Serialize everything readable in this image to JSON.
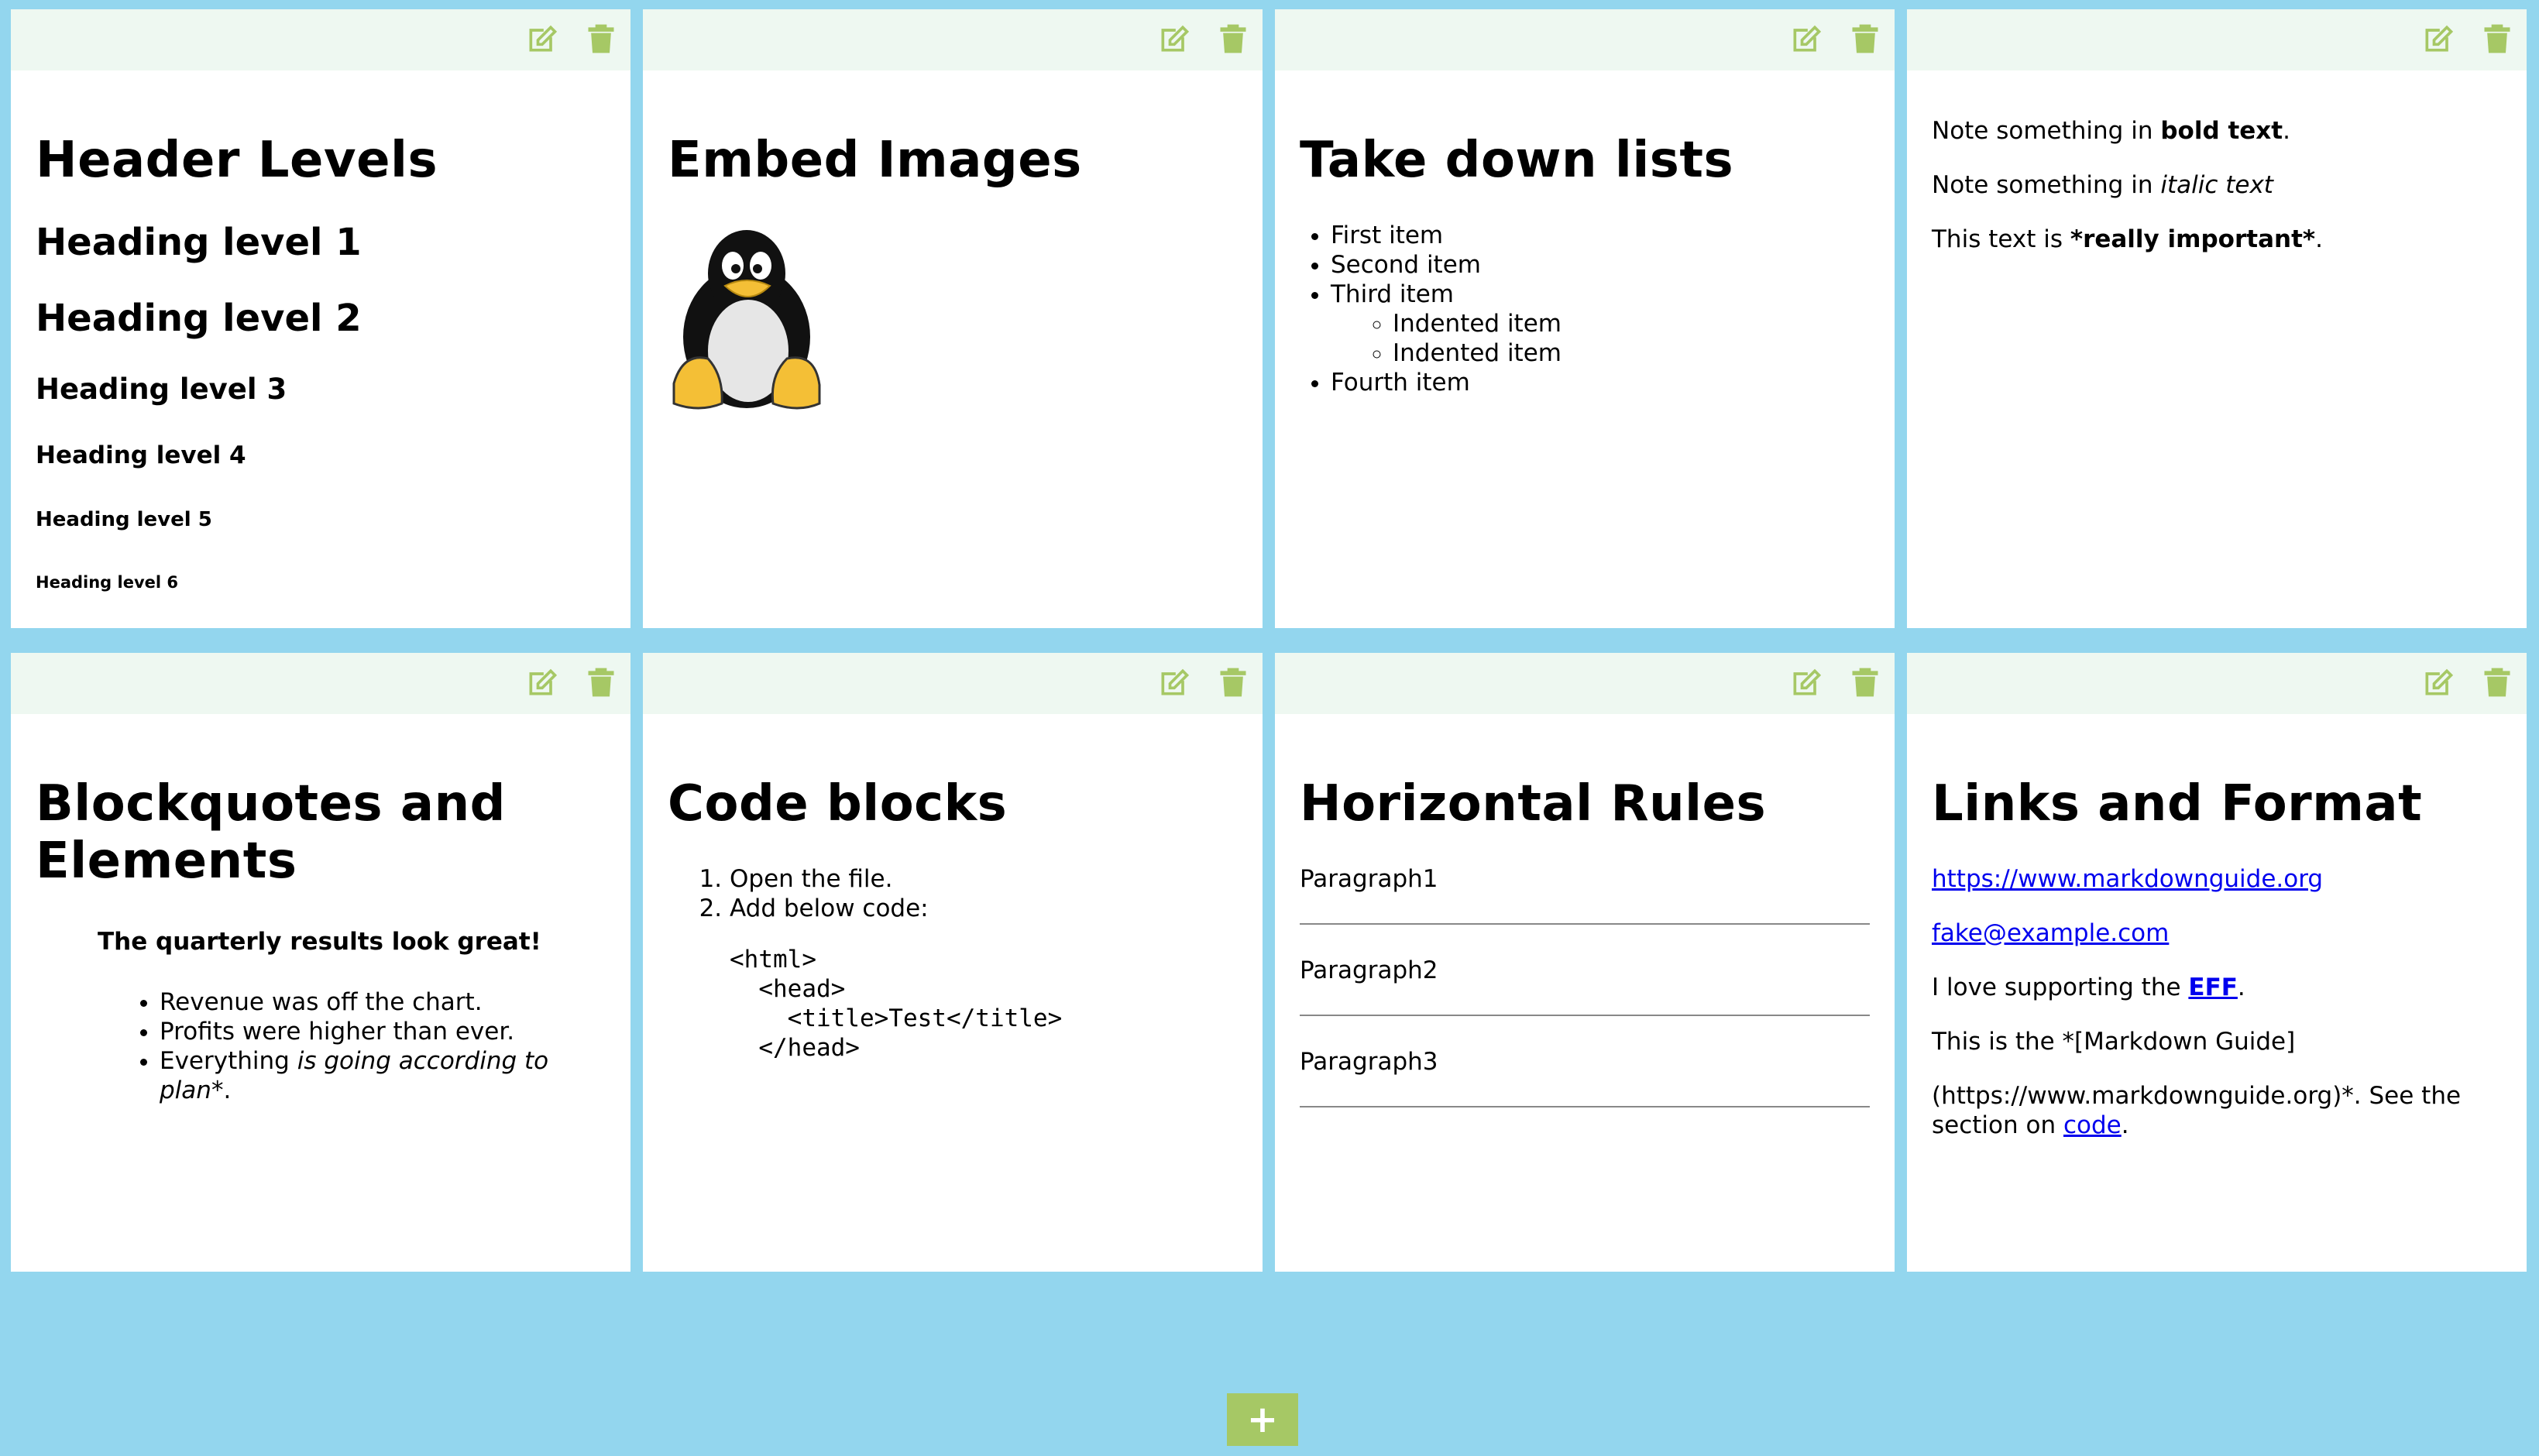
{
  "colors": {
    "background": "#93d6ee",
    "toolbar": "#eef8f1",
    "icon": "#a6c865",
    "accent": "#a6c865",
    "link": "#0000ee"
  },
  "icons": {
    "edit": "edit-icon",
    "delete": "trash-icon",
    "add": "plus-icon"
  },
  "notes": [
    {
      "title": "Header Levels",
      "levels": [
        "Heading level 1",
        "Heading level 2",
        "Heading level 3",
        "Heading level 4",
        "Heading level 5",
        "Heading level 6"
      ]
    },
    {
      "title": "Embed Images",
      "image": "linux-penguin-tux"
    },
    {
      "title": "Take down lists",
      "items": [
        "First item",
        "Second item",
        "Third item",
        "Fourth item"
      ],
      "subitems": [
        "Indented item",
        "Indented item"
      ]
    },
    {
      "line1_pre": "Note something in ",
      "line1_bold": "bold text",
      "line1_post": ".",
      "line2_pre": "Note something in ",
      "line2_italic": "italic text",
      "line3_pre": "This text is ",
      "line3_bold": "*really important*",
      "line3_post": "."
    },
    {
      "title": "Blockquotes and Elements",
      "quote": "The quarterly results look great!",
      "items": [
        "Revenue was off the chart.",
        "Profits were higher than ever."
      ],
      "item3_pre": "Everything ",
      "item3_italic": "is going according to plan",
      "item3_post": "*."
    },
    {
      "title": "Code blocks",
      "steps": [
        "Open the file.",
        "Add below code:"
      ],
      "code": "<html>\n  <head>\n    <title>Test</title>\n  </head>"
    },
    {
      "title": "Horizontal Rules",
      "paragraphs": [
        "Paragraph1",
        "Paragraph2",
        "Paragraph3"
      ]
    },
    {
      "title": "Links and Format",
      "url": "https://www.markdownguide.org",
      "email": "fake@example.com",
      "love_pre": "I love supporting the ",
      "love_link": "EFF",
      "love_post": ".",
      "guide_line": "This is the *[Markdown Guide]",
      "guide_url_pre": "(https://www.markdownguide.org)*. See the section on ",
      "guide_code": "code",
      "guide_post": "."
    }
  ],
  "add_button": "+"
}
